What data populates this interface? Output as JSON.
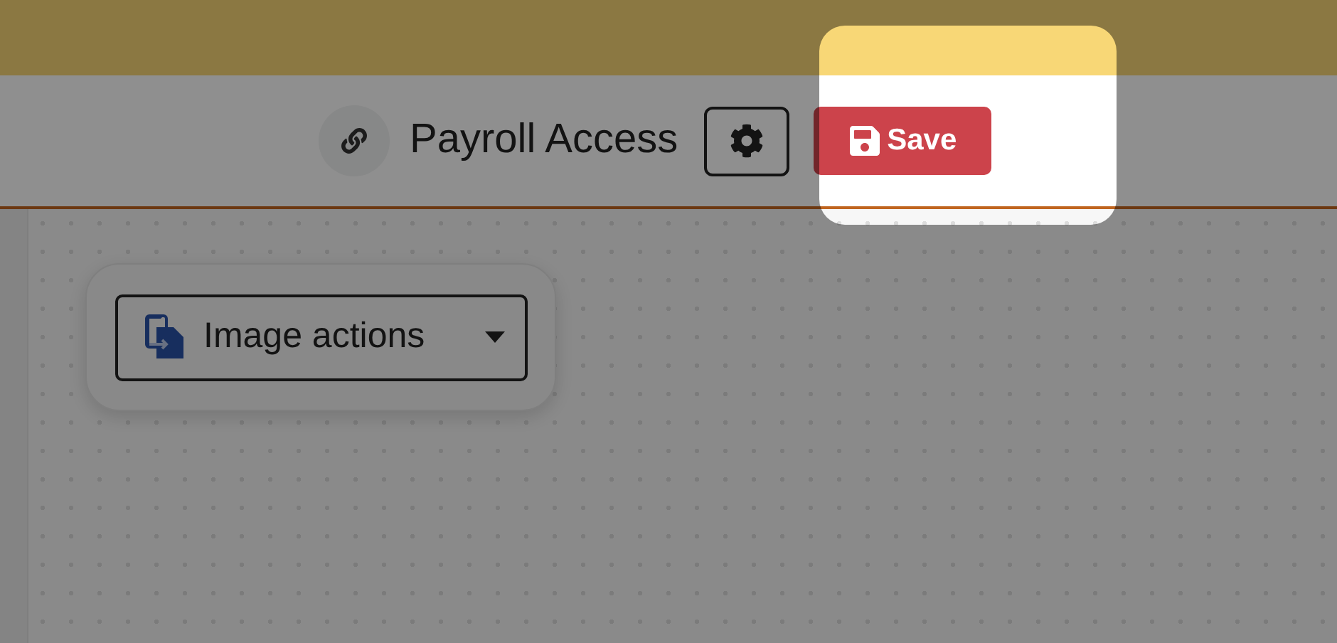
{
  "header": {
    "title": "Payroll Access",
    "save_button": {
      "label": "Save",
      "highlighted": true
    }
  },
  "canvas": {
    "toolbar": {
      "image_actions": "Image actions"
    }
  }
}
